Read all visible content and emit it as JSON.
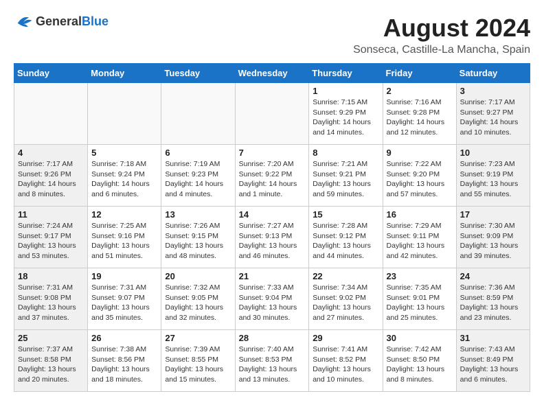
{
  "header": {
    "logo_general": "General",
    "logo_blue": "Blue",
    "title": "August 2024",
    "location": "Sonseca, Castille-La Mancha, Spain"
  },
  "weekdays": [
    "Sunday",
    "Monday",
    "Tuesday",
    "Wednesday",
    "Thursday",
    "Friday",
    "Saturday"
  ],
  "weeks": [
    [
      {
        "day": "",
        "info": ""
      },
      {
        "day": "",
        "info": ""
      },
      {
        "day": "",
        "info": ""
      },
      {
        "day": "",
        "info": ""
      },
      {
        "day": "1",
        "info": "Sunrise: 7:15 AM\nSunset: 9:29 PM\nDaylight: 14 hours and 14 minutes."
      },
      {
        "day": "2",
        "info": "Sunrise: 7:16 AM\nSunset: 9:28 PM\nDaylight: 14 hours and 12 minutes."
      },
      {
        "day": "3",
        "info": "Sunrise: 7:17 AM\nSunset: 9:27 PM\nDaylight: 14 hours and 10 minutes."
      }
    ],
    [
      {
        "day": "4",
        "info": "Sunrise: 7:17 AM\nSunset: 9:26 PM\nDaylight: 14 hours and 8 minutes."
      },
      {
        "day": "5",
        "info": "Sunrise: 7:18 AM\nSunset: 9:24 PM\nDaylight: 14 hours and 6 minutes."
      },
      {
        "day": "6",
        "info": "Sunrise: 7:19 AM\nSunset: 9:23 PM\nDaylight: 14 hours and 4 minutes."
      },
      {
        "day": "7",
        "info": "Sunrise: 7:20 AM\nSunset: 9:22 PM\nDaylight: 14 hours and 1 minute."
      },
      {
        "day": "8",
        "info": "Sunrise: 7:21 AM\nSunset: 9:21 PM\nDaylight: 13 hours and 59 minutes."
      },
      {
        "day": "9",
        "info": "Sunrise: 7:22 AM\nSunset: 9:20 PM\nDaylight: 13 hours and 57 minutes."
      },
      {
        "day": "10",
        "info": "Sunrise: 7:23 AM\nSunset: 9:19 PM\nDaylight: 13 hours and 55 minutes."
      }
    ],
    [
      {
        "day": "11",
        "info": "Sunrise: 7:24 AM\nSunset: 9:17 PM\nDaylight: 13 hours and 53 minutes."
      },
      {
        "day": "12",
        "info": "Sunrise: 7:25 AM\nSunset: 9:16 PM\nDaylight: 13 hours and 51 minutes."
      },
      {
        "day": "13",
        "info": "Sunrise: 7:26 AM\nSunset: 9:15 PM\nDaylight: 13 hours and 48 minutes."
      },
      {
        "day": "14",
        "info": "Sunrise: 7:27 AM\nSunset: 9:13 PM\nDaylight: 13 hours and 46 minutes."
      },
      {
        "day": "15",
        "info": "Sunrise: 7:28 AM\nSunset: 9:12 PM\nDaylight: 13 hours and 44 minutes."
      },
      {
        "day": "16",
        "info": "Sunrise: 7:29 AM\nSunset: 9:11 PM\nDaylight: 13 hours and 42 minutes."
      },
      {
        "day": "17",
        "info": "Sunrise: 7:30 AM\nSunset: 9:09 PM\nDaylight: 13 hours and 39 minutes."
      }
    ],
    [
      {
        "day": "18",
        "info": "Sunrise: 7:31 AM\nSunset: 9:08 PM\nDaylight: 13 hours and 37 minutes."
      },
      {
        "day": "19",
        "info": "Sunrise: 7:31 AM\nSunset: 9:07 PM\nDaylight: 13 hours and 35 minutes."
      },
      {
        "day": "20",
        "info": "Sunrise: 7:32 AM\nSunset: 9:05 PM\nDaylight: 13 hours and 32 minutes."
      },
      {
        "day": "21",
        "info": "Sunrise: 7:33 AM\nSunset: 9:04 PM\nDaylight: 13 hours and 30 minutes."
      },
      {
        "day": "22",
        "info": "Sunrise: 7:34 AM\nSunset: 9:02 PM\nDaylight: 13 hours and 27 minutes."
      },
      {
        "day": "23",
        "info": "Sunrise: 7:35 AM\nSunset: 9:01 PM\nDaylight: 13 hours and 25 minutes."
      },
      {
        "day": "24",
        "info": "Sunrise: 7:36 AM\nSunset: 8:59 PM\nDaylight: 13 hours and 23 minutes."
      }
    ],
    [
      {
        "day": "25",
        "info": "Sunrise: 7:37 AM\nSunset: 8:58 PM\nDaylight: 13 hours and 20 minutes."
      },
      {
        "day": "26",
        "info": "Sunrise: 7:38 AM\nSunset: 8:56 PM\nDaylight: 13 hours and 18 minutes."
      },
      {
        "day": "27",
        "info": "Sunrise: 7:39 AM\nSunset: 8:55 PM\nDaylight: 13 hours and 15 minutes."
      },
      {
        "day": "28",
        "info": "Sunrise: 7:40 AM\nSunset: 8:53 PM\nDaylight: 13 hours and 13 minutes."
      },
      {
        "day": "29",
        "info": "Sunrise: 7:41 AM\nSunset: 8:52 PM\nDaylight: 13 hours and 10 minutes."
      },
      {
        "day": "30",
        "info": "Sunrise: 7:42 AM\nSunset: 8:50 PM\nDaylight: 13 hours and 8 minutes."
      },
      {
        "day": "31",
        "info": "Sunrise: 7:43 AM\nSunset: 8:49 PM\nDaylight: 13 hours and 6 minutes."
      }
    ]
  ]
}
